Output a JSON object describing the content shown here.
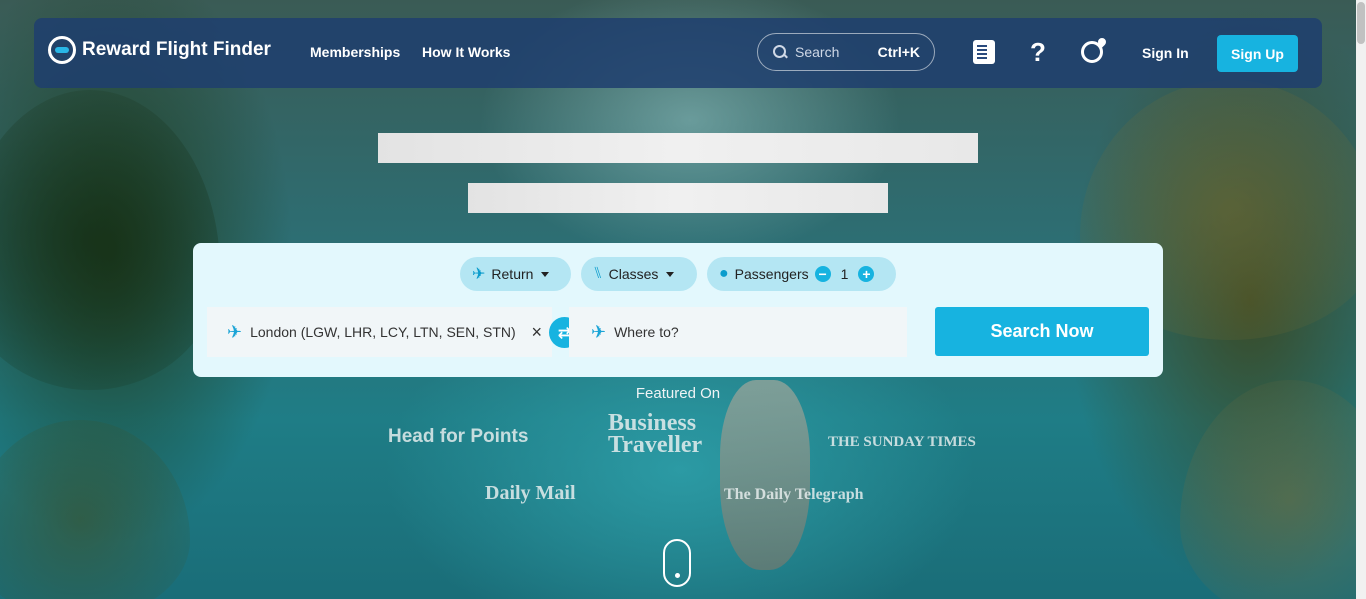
{
  "header": {
    "brand": "Reward Flight Finder",
    "nav": [
      "Memberships",
      "How It Works"
    ],
    "search": {
      "placeholder": "Search",
      "shortcut": "Ctrl+K"
    },
    "help_glyph": "?",
    "sign_in": "Sign In",
    "sign_up": "Sign Up"
  },
  "search_card": {
    "trip_type": "Return",
    "classes": "Classes",
    "passengers_label": "Passengers",
    "passengers_count": "1",
    "origin": "London (LGW, LHR, LCY, LTN, SEN, STN)",
    "destination_placeholder": "Where to?",
    "search_button": "Search Now"
  },
  "featured": {
    "label": "Featured On",
    "outlets": [
      "Head for Points",
      "Business Traveller",
      "THE SUNDAY TIMES",
      "Daily Mail",
      "The Daily Telegraph"
    ]
  },
  "icons": {
    "news": "newspaper-icon",
    "help": "question-icon",
    "region": "globe-icon",
    "swap": "swap-icon"
  },
  "colors": {
    "accent": "#17b3e0",
    "header_bg": "#1e3e6e",
    "card_bg": "#e3f8fd",
    "pill_bg": "#b4e6f3"
  }
}
